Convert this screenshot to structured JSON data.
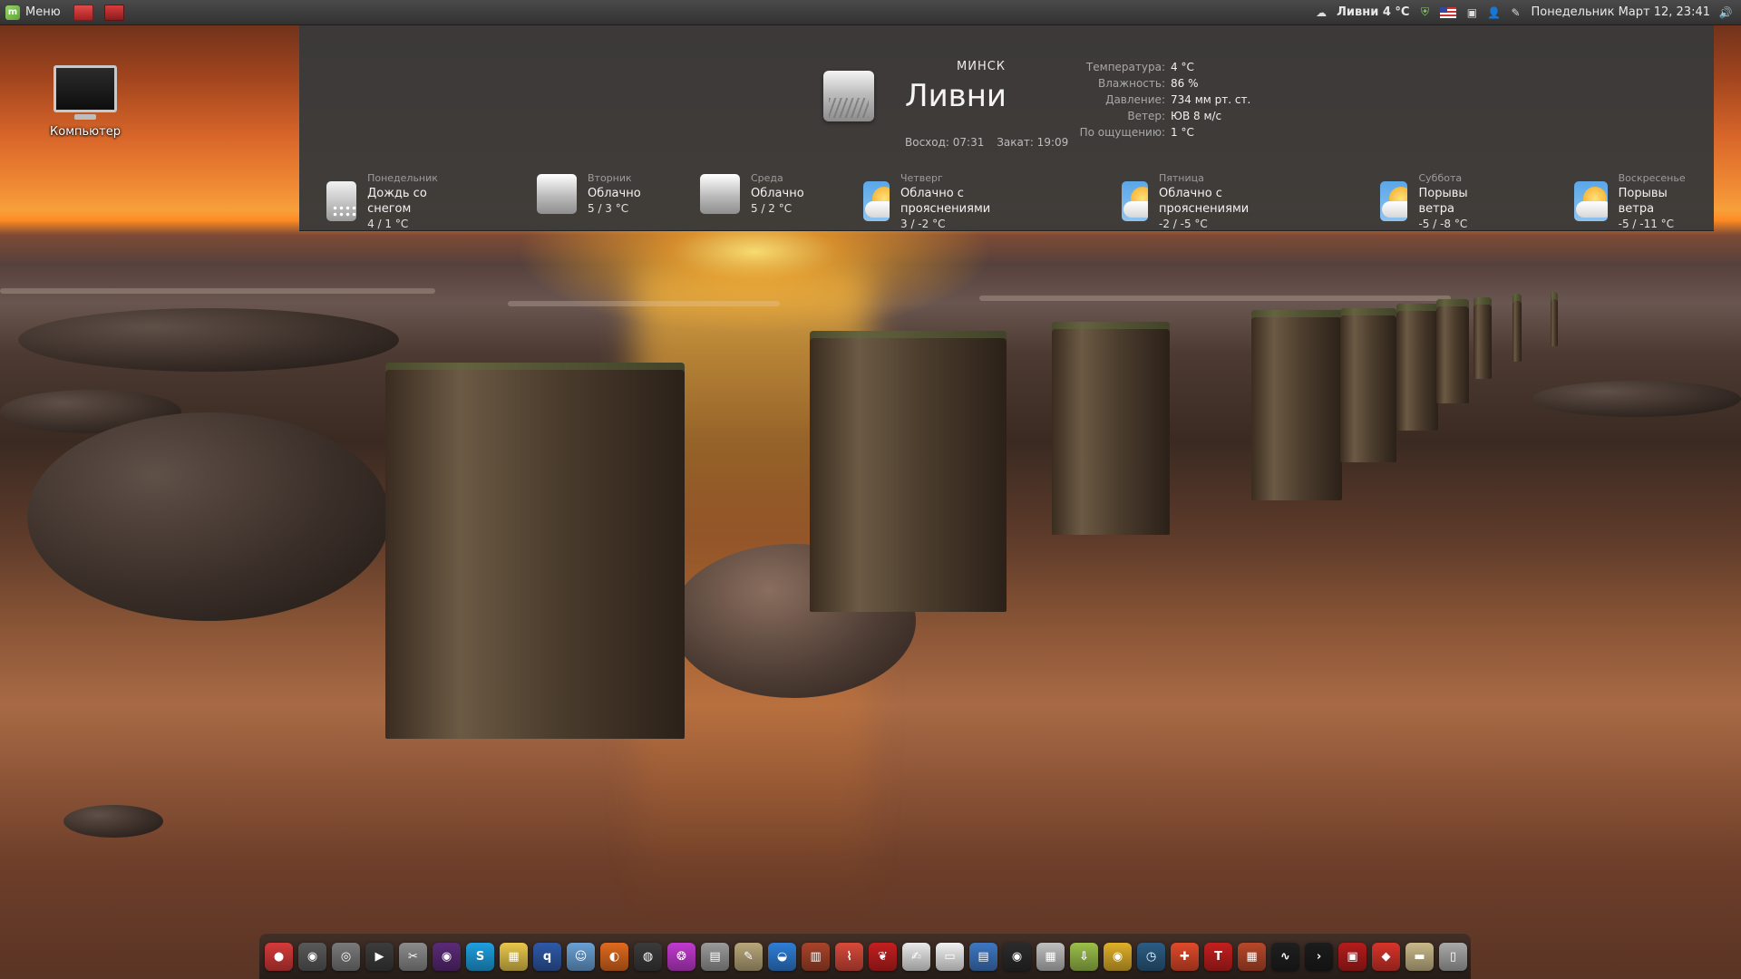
{
  "top_panel": {
    "menu_label": "Меню",
    "weather_applet": "Ливни 4 °C",
    "datetime": "Понедельник Март 12, 23:41"
  },
  "desktop": {
    "computer_icon_label": "Компьютер"
  },
  "weather": {
    "city": "МИНСК",
    "condition": "Ливни",
    "sunrise": "Восход: 07:31",
    "sunset": "Закат: 19:09",
    "details": [
      {
        "label": "Температура:",
        "value": "4 °C"
      },
      {
        "label": "Влажность:",
        "value": "86 %"
      },
      {
        "label": "Давление:",
        "value": "734 мм рт. ст."
      },
      {
        "label": "Ветер:",
        "value": "ЮВ 8 м/с"
      },
      {
        "label": "По ощущению:",
        "value": "1 °C"
      }
    ],
    "forecast": [
      {
        "day": "Понедельник",
        "condition": "Дождь со снегом",
        "temp": "4 / 1 °C",
        "icon": "sleet-icon"
      },
      {
        "day": "Вторник",
        "condition": "Облачно",
        "temp": "5 / 3 °C",
        "icon": "cloud-icon"
      },
      {
        "day": "Среда",
        "condition": "Облачно",
        "temp": "5 / 2 °C",
        "icon": "cloud-icon"
      },
      {
        "day": "Четверг",
        "condition": "Облачно с прояснениями",
        "temp": "3 / -2 °C",
        "icon": "partly-cloudy-icon"
      },
      {
        "day": "Пятница",
        "condition": "Облачно с прояснениями",
        "temp": "-2 / -5 °C",
        "icon": "partly-cloudy-icon"
      },
      {
        "day": "Суббота",
        "condition": "Порывы ветра",
        "temp": "-5 / -8 °C",
        "icon": "partly-cloudy-icon"
      },
      {
        "day": "Воскресенье",
        "condition": "Порывы ветра",
        "temp": "-5 / -11 °C",
        "icon": "partly-cloudy-icon"
      }
    ]
  },
  "dock": {
    "items": [
      {
        "name": "recorder-icon",
        "color": "#d63a3a",
        "glyph": "●"
      },
      {
        "name": "camera-icon",
        "color": "#5a5a5a",
        "glyph": "◉"
      },
      {
        "name": "webcam-icon",
        "color": "#7a7a7a",
        "glyph": "◎"
      },
      {
        "name": "video-player-icon",
        "color": "#3c3c3c",
        "glyph": "▶"
      },
      {
        "name": "clapper-icon",
        "color": "#8c8c8c",
        "glyph": "✂"
      },
      {
        "name": "music-player-icon",
        "color": "#5b2a78",
        "glyph": "◉"
      },
      {
        "name": "skype-icon",
        "color": "#1ea0e0",
        "glyph": "S"
      },
      {
        "name": "sticky-notes-icon",
        "color": "#e8c84a",
        "glyph": "▦"
      },
      {
        "name": "qbittorrent-icon",
        "color": "#2f5aa8",
        "glyph": "q"
      },
      {
        "name": "finder-icon",
        "color": "#6aa1d6",
        "glyph": "☺"
      },
      {
        "name": "firefox-icon",
        "color": "#e06a1e",
        "glyph": "◐"
      },
      {
        "name": "globe-icon",
        "color": "#3b3b3b",
        "glyph": "◍"
      },
      {
        "name": "color-wheel-icon",
        "color": "#c23ad0",
        "glyph": "❂"
      },
      {
        "name": "image-viewer-icon",
        "color": "#9a9a9a",
        "glyph": "▤"
      },
      {
        "name": "document-viewer-icon",
        "color": "#b8a77a",
        "glyph": "✎"
      },
      {
        "name": "network-icon",
        "color": "#2f7ed6",
        "glyph": "◒"
      },
      {
        "name": "book-icon",
        "color": "#a8442a",
        "glyph": "▥"
      },
      {
        "name": "system-monitor-icon",
        "color": "#d84a3a",
        "glyph": "⌇"
      },
      {
        "name": "cherry-icon",
        "color": "#c41f1f",
        "glyph": "❦"
      },
      {
        "name": "text-editor-icon",
        "color": "#eaeaea",
        "glyph": "✍"
      },
      {
        "name": "file-icon",
        "color": "#f2f2f2",
        "glyph": "▭"
      },
      {
        "name": "writer-icon",
        "color": "#3e78c2",
        "glyph": "▤"
      },
      {
        "name": "dvd-icon",
        "color": "#2b2b2b",
        "glyph": "◉"
      },
      {
        "name": "calculator-icon",
        "color": "#bfbfbf",
        "glyph": "▦"
      },
      {
        "name": "downloader-icon",
        "color": "#9bbf4a",
        "glyph": "⇩"
      },
      {
        "name": "chrome-icon",
        "color": "#e0b02a",
        "glyph": "◉"
      },
      {
        "name": "clock-icon",
        "color": "#2b5d84",
        "glyph": "◷"
      },
      {
        "name": "clipboard-icon",
        "color": "#e04a2a",
        "glyph": "✚"
      },
      {
        "name": "typography-icon",
        "color": "#c41f1f",
        "glyph": "T"
      },
      {
        "name": "firewall-icon",
        "color": "#b8482a",
        "glyph": "▦"
      },
      {
        "name": "activity-monitor-icon",
        "color": "#1f1f1f",
        "glyph": "∿"
      },
      {
        "name": "terminal-icon",
        "color": "#1c1c1c",
        "glyph": "›"
      },
      {
        "name": "presentation-icon",
        "color": "#b51c1c",
        "glyph": "▣"
      },
      {
        "name": "ruby-icon",
        "color": "#d8342a",
        "glyph": "◆"
      },
      {
        "name": "folder-icon",
        "color": "#c9b98a",
        "glyph": "▬"
      },
      {
        "name": "trash-icon",
        "color": "#a9a9a9",
        "glyph": "▯"
      }
    ]
  }
}
